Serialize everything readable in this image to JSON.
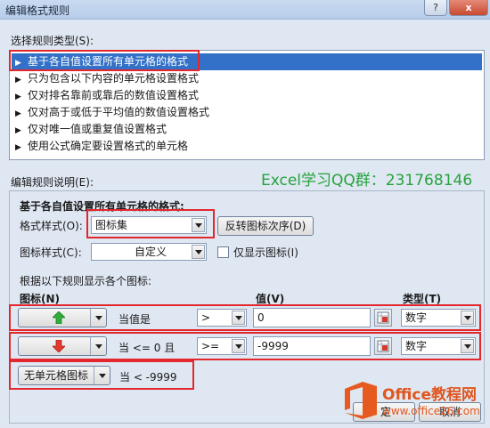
{
  "window": {
    "title": "编辑格式规则",
    "help_label": "?",
    "close_label": "x"
  },
  "rule_type": {
    "label": "选择规则类型(S):",
    "items": [
      "基于各自值设置所有单元格的格式",
      "只为包含以下内容的单元格设置格式",
      "仅对排名靠前或靠后的数值设置格式",
      "仅对高于或低于平均值的数值设置格式",
      "仅对唯一值或重复值设置格式",
      "使用公式确定要设置格式的单元格"
    ],
    "selected_index": 0
  },
  "description": {
    "label": "编辑规则说明(E):",
    "heading": "基于各自值设置所有单元格的格式:",
    "format_style_label": "格式样式(O):",
    "format_style_value": "图标集",
    "reverse_button": "反转图标次序(D)",
    "icon_style_label": "图标样式(C):",
    "icon_style_value": "自定义",
    "show_icon_only_label": "仅显示图标(I)",
    "show_icon_only_checked": false,
    "rules_caption": "根据以下规则显示各个图标:"
  },
  "columns": {
    "icon": "图标(N)",
    "value": "值(V)",
    "type": "类型(T)"
  },
  "icon_rules": [
    {
      "icon": "green-up-arrow-icon",
      "condition": "当值是",
      "operator": ">",
      "value": "0",
      "type": "数字"
    },
    {
      "icon": "red-down-arrow-icon",
      "condition": "当 <= 0 且",
      "operator": ">=",
      "value": "-9999",
      "type": "数字"
    },
    {
      "icon_text": "无单元格图标",
      "condition": "当 < -9999"
    }
  ],
  "footer": {
    "ok_partial": "定",
    "cancel_partial": "取消"
  },
  "watermark": "Excel学习QQ群：231768146",
  "badge": {
    "name": "Office教程网",
    "url": "www.office26.com"
  },
  "colors": {
    "selection": "#3271c7",
    "highlight": "#e3272d",
    "watermark": "#26a33c",
    "up_arrow": "#2fae3a",
    "down_arrow": "#e03b2f"
  }
}
